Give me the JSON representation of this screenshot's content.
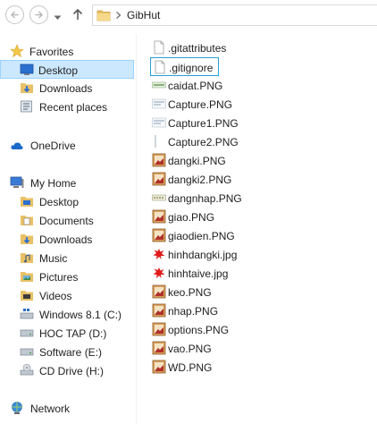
{
  "window": {
    "path": [
      "GibHut"
    ]
  },
  "icons": {
    "back": "back-arrow-icon",
    "forward": "forward-arrow-icon",
    "recent": "chevron-down-icon",
    "up": "up-arrow-icon",
    "folder": "folder-icon"
  },
  "colors": {
    "selection_bg": "#cce8ff",
    "selection_border": "#99d1ff",
    "focus_border": "#26a0da"
  },
  "nav": {
    "favorites": "Favorites",
    "favorites_items": [
      "Desktop",
      "Downloads",
      "Recent places"
    ],
    "onedrive": "OneDrive",
    "myhome": "My Home",
    "myhome_items": [
      "Desktop",
      "Documents",
      "Downloads",
      "Music",
      "Pictures",
      "Videos",
      "Windows 8.1 (C:)",
      "HOC TAP (D:)",
      "Software (E:)",
      "CD Drive (H:)"
    ],
    "network": "Network",
    "selected": "Desktop"
  },
  "files": [
    {
      "name": ".gitattributes",
      "icon": "blank-file-icon"
    },
    {
      "name": ".gitignore",
      "icon": "blank-file-icon"
    },
    {
      "name": "caidat.PNG",
      "icon": "png-thumbnail-icon"
    },
    {
      "name": "Capture.PNG",
      "icon": "png-thumbnail-icon"
    },
    {
      "name": "Capture1.PNG",
      "icon": "png-thumbnail-icon"
    },
    {
      "name": "Capture2.PNG",
      "icon": "png-thumbnail-icon"
    },
    {
      "name": "dangki.PNG",
      "icon": "image-file-icon"
    },
    {
      "name": "dangki2.PNG",
      "icon": "image-file-icon"
    },
    {
      "name": "dangnhap.PNG",
      "icon": "png-thumbnail-icon"
    },
    {
      "name": "giao.PNG",
      "icon": "image-file-icon"
    },
    {
      "name": "giaodien.PNG",
      "icon": "image-file-icon"
    },
    {
      "name": "hinhdangki.jpg",
      "icon": "red-splash-thumbnail-icon"
    },
    {
      "name": "hinhtaive.jpg",
      "icon": "red-splash-thumbnail-icon"
    },
    {
      "name": "keo.PNG",
      "icon": "image-file-icon"
    },
    {
      "name": "nhap.PNG",
      "icon": "image-file-icon"
    },
    {
      "name": "options.PNG",
      "icon": "image-file-icon"
    },
    {
      "name": "vao.PNG",
      "icon": "image-file-icon"
    },
    {
      "name": "WD.PNG",
      "icon": "image-file-icon"
    }
  ],
  "focused_file": ".gitignore"
}
